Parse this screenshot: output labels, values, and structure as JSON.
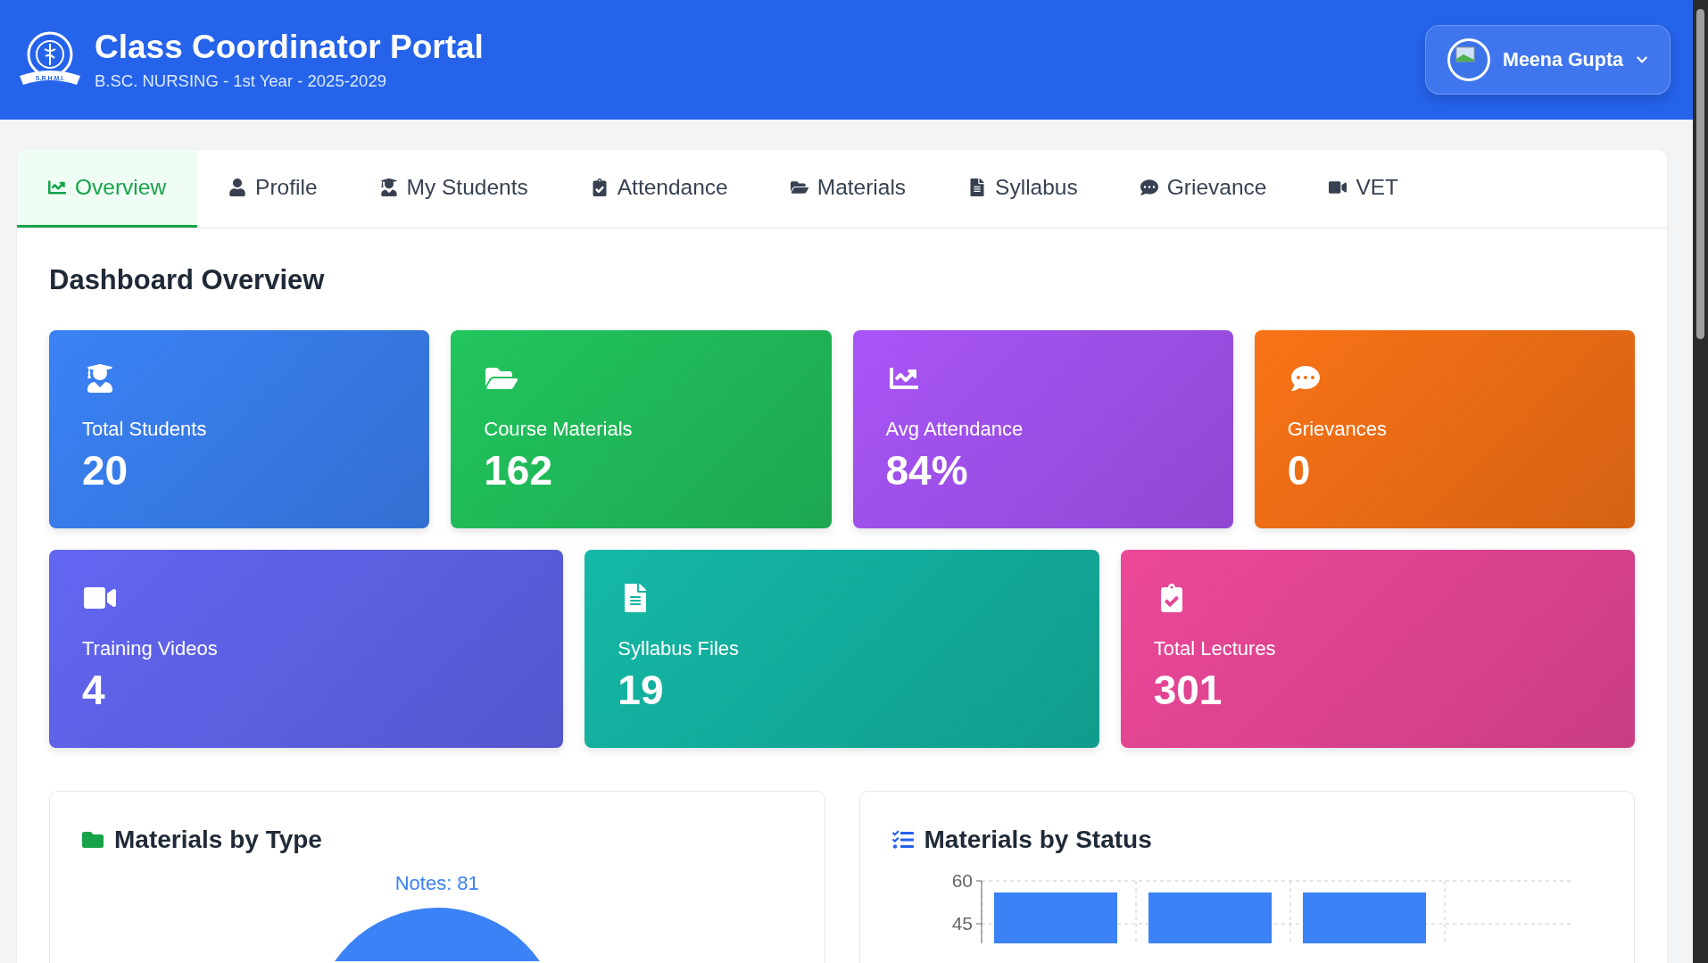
{
  "header": {
    "logo_text": "S.R.H.M.I.",
    "title": "Class Coordinator Portal",
    "subtitle": "B.SC. NURSING - 1st Year - 2025-2029",
    "user": {
      "name": "Meena Gupta"
    }
  },
  "tabs": [
    {
      "label": "Overview",
      "selected": true
    },
    {
      "label": "Profile",
      "selected": false
    },
    {
      "label": "My Students",
      "selected": false
    },
    {
      "label": "Attendance",
      "selected": false
    },
    {
      "label": "Materials",
      "selected": false
    },
    {
      "label": "Syllabus",
      "selected": false
    },
    {
      "label": "Grievance",
      "selected": false
    },
    {
      "label": "VET",
      "selected": false
    }
  ],
  "heading": "Dashboard Overview",
  "stats_row_1": [
    {
      "label": "Total Students",
      "value": "20",
      "color": "#3b82f6"
    },
    {
      "label": "Course Materials",
      "value": "162",
      "color": "#22c55e"
    },
    {
      "label": "Avg Attendance",
      "value": "84%",
      "color": "#a855f7"
    },
    {
      "label": "Grievances",
      "value": "0",
      "color": "#f97316"
    }
  ],
  "stats_row_2": [
    {
      "label": "Training Videos",
      "value": "4",
      "color": "#6366f1"
    },
    {
      "label": "Syllabus Files",
      "value": "19",
      "color": "#14b8a6"
    },
    {
      "label": "Total Lectures",
      "value": "301",
      "color": "#ec4899"
    }
  ],
  "panels": [
    {
      "title": "Materials by Type",
      "kind": "pie",
      "slice_label": "Notes: 81"
    },
    {
      "title": "Materials by Status",
      "kind": "bar",
      "axis_labels": [
        "60",
        "45"
      ]
    }
  ]
}
